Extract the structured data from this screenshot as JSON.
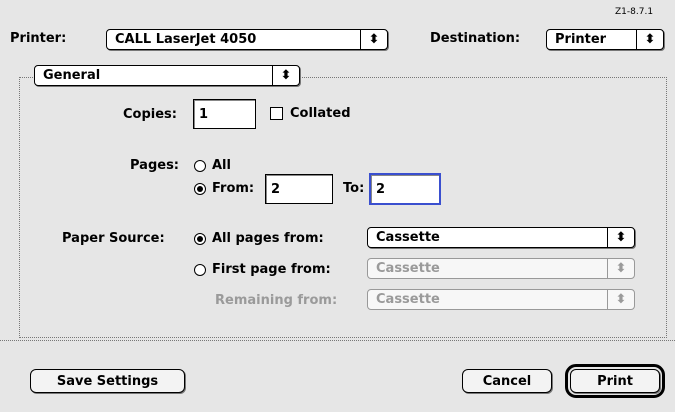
{
  "version": "Z1-8.7.1",
  "printer": {
    "label": "Printer:",
    "value": "CALL LaserJet 4050"
  },
  "destination": {
    "label": "Destination:",
    "value": "Printer"
  },
  "panel": {
    "value": "General"
  },
  "copies": {
    "label": "Copies:",
    "value": "1",
    "collated_label": "Collated",
    "collated": false
  },
  "pages": {
    "label": "Pages:",
    "all_label": "All",
    "from_label": "From:",
    "from_value": "2",
    "to_label": "To:",
    "to_value": "2",
    "selected": "from"
  },
  "paper_source": {
    "label": "Paper Source:",
    "all_pages_label": "All pages from:",
    "all_pages_value": "Cassette",
    "first_page_label": "First page from:",
    "first_page_value": "Cassette",
    "remaining_label": "Remaining from:",
    "remaining_value": "Cassette",
    "selected": "all"
  },
  "buttons": {
    "save": "Save Settings",
    "cancel": "Cancel",
    "print": "Print"
  },
  "arrows_glyph": "⬍"
}
